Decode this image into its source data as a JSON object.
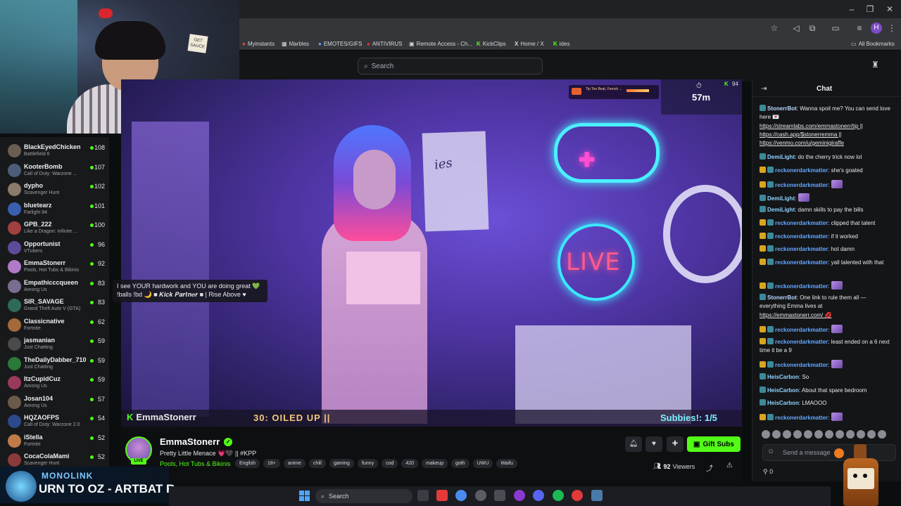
{
  "browser": {
    "bookmarks": [
      {
        "label": "Myinstants",
        "icon": "bookmark-icon"
      },
      {
        "label": "Marbles",
        "icon": "grid-icon"
      },
      {
        "label": "EMOTES/GIFS",
        "icon": "globe-icon"
      },
      {
        "label": "ANTIVIRUS",
        "icon": "shield-icon"
      },
      {
        "label": "Remote Access - Ch...",
        "icon": "remote-icon"
      },
      {
        "label": "KickClips",
        "icon": "kick-icon"
      },
      {
        "label": "Home / X",
        "icon": "x-icon"
      },
      {
        "label": "ides",
        "icon": "kick-icon"
      }
    ],
    "all_bookmarks": "All Bookmarks",
    "profile_initial": "H"
  },
  "header": {
    "search_placeholder": "Search"
  },
  "sidebar": {
    "channels": [
      {
        "name": "BlackEyedChicken",
        "category": "Battlefield 6",
        "viewers": "108",
        "color": "#6a5d52"
      },
      {
        "name": "KooterBomb",
        "category": "Call of Duty: Warzone ...",
        "viewers": "107",
        "color": "#4c5d7a"
      },
      {
        "name": "dypho",
        "category": "Scavenger Hunt",
        "viewers": "102",
        "color": "#8a7b6a"
      },
      {
        "name": "bluetearz",
        "category": "Farlight 84",
        "viewers": "101",
        "color": "#3a5fb0"
      },
      {
        "name": "GPB_222",
        "category": "Like a Dragon: Infinite ...",
        "viewers": "100",
        "color": "#a04040"
      },
      {
        "name": "Opportunist",
        "category": "VTubers",
        "viewers": "96",
        "color": "#5d4b9a"
      },
      {
        "name": "EmmaStonerr",
        "category": "Pools, Hot Tubs & Bikinis",
        "viewers": "92",
        "color": "#b07ac9"
      },
      {
        "name": "Empathicccqueen",
        "category": "Among Us",
        "viewers": "83",
        "color": "#7a6e90"
      },
      {
        "name": "SIR_SAVAGE",
        "category": "Grand Theft Auto V (GTA)",
        "viewers": "83",
        "color": "#2f6a58"
      },
      {
        "name": "Classicnative",
        "category": "Fortnite",
        "viewers": "62",
        "color": "#a46a3b"
      },
      {
        "name": "jasmanian",
        "category": "Just Chatting",
        "viewers": "59",
        "color": "#4a4a4a"
      },
      {
        "name": "TheDailyDabber_710",
        "category": "Just Chatting",
        "viewers": "59",
        "color": "#2a7a3a"
      },
      {
        "name": "ItzCupidCuz",
        "category": "Among Us",
        "viewers": "59",
        "color": "#9a3a5a"
      },
      {
        "name": "Josan104",
        "category": "Among Us",
        "viewers": "57",
        "color": "#6a5a4a"
      },
      {
        "name": "HQZAOFPS",
        "category": "Call of Duty: Warzone 2.0",
        "viewers": "54",
        "color": "#2a4a8a"
      },
      {
        "name": "iStella",
        "category": "Fortnite",
        "viewers": "52",
        "color": "#c07a4a"
      },
      {
        "name": "CocaColaMami",
        "category": "Scavenger Hunt",
        "viewers": "52",
        "color": "#8a3a3a"
      }
    ]
  },
  "webcam": {
    "sign_text": "GET SAUCE"
  },
  "video": {
    "overlay_name": "EmmaStonerr",
    "goal_text": "30: OILED UP ||",
    "subbies": "Subbies!: 1/5",
    "alert_text": "Tip Toe Beat, French ...",
    "timer_count": "94",
    "timer_time": "57m",
    "board_text": "ies",
    "neon_live": "LIVE"
  },
  "tooltip": {
    "line1": "I see YOUR hardwork and YOU are doing great 💚",
    "line2": "!balls !bd 🌙 ■ 𝑲𝒊𝒄𝒌 𝑷𝒂𝒓𝒕𝒏𝒆𝒓 ■ | Rise Above ♥"
  },
  "stream_info": {
    "name": "EmmaStonerr",
    "live_badge": "LIVE",
    "title": "Pretty Little Menace 💗🖤 || #KPP",
    "category": "Pools, Hot Tubs & Bikinis",
    "tags": [
      "English",
      "18+",
      "anime",
      "chill",
      "gaming",
      "funny",
      "cod",
      "420",
      "makeup",
      "goth",
      "UWU",
      "Waifu"
    ],
    "gift_subs": "Gift Subs",
    "viewers": "92",
    "viewers_label": "Viewers"
  },
  "chat": {
    "title": "Chat",
    "input_placeholder": "Send a message",
    "points": "0",
    "messages": [
      {
        "user": "StonerrBot",
        "color": "#b8d7ff",
        "text": ": Wanna spoil me? You can send love here 💌"
      },
      {
        "user": "",
        "color": "",
        "text": "https://streamlabs.com/emmastonerr/tip ||"
      },
      {
        "user": "",
        "color": "",
        "text": "https://cash.app/$stonerremma ||"
      },
      {
        "user": "",
        "color": "",
        "text": "https://venmo.com/u/geminigiraffe"
      },
      {
        "user": "DemiLight",
        "color": "#8fd3ff",
        "text": ": do the cherry trick now lol"
      },
      {
        "user": "reckonerdarkmatter",
        "color": "#64a7ff",
        "text": ": she's goated"
      },
      {
        "user": "reckonerdarkmatter",
        "color": "#64a7ff",
        "text": ":"
      },
      {
        "user": "DemiLight",
        "color": "#8fd3ff",
        "text": ":"
      },
      {
        "user": "DemiLight",
        "color": "#8fd3ff",
        "text": ": damn skills to pay the bills"
      },
      {
        "user": "reckonerdarkmatter",
        "color": "#64a7ff",
        "text": ": clipped that talent"
      },
      {
        "user": "reckonerdarkmatter",
        "color": "#64a7ff",
        "text": ": if it worked"
      },
      {
        "user": "reckonerdarkmatter",
        "color": "#64a7ff",
        "text": ": hot damn"
      },
      {
        "user": "reckonerdarkmatter",
        "color": "#64a7ff",
        "text": ": yall talented with that"
      },
      {
        "user": "reckonerdarkmatter",
        "color": "#64a7ff",
        "text": ":"
      },
      {
        "user": "StonerrBot",
        "color": "#b8d7ff",
        "text": ": One link to rule them all — everything Emma lives at"
      },
      {
        "user": "",
        "color": "",
        "text": "https://emmastonerr.com/ 💋"
      },
      {
        "user": "reckonerdarkmatter",
        "color": "#64a7ff",
        "text": ":"
      },
      {
        "user": "reckonerdarkmatter",
        "color": "#64a7ff",
        "text": ": least ended on a 6 next time it be a 9"
      },
      {
        "user": "reckonerdarkmatter",
        "color": "#64a7ff",
        "text": ":"
      },
      {
        "user": "HeisCarbon",
        "color": "#8fd3ff",
        "text": ": So"
      },
      {
        "user": "HeisCarbon",
        "color": "#8fd3ff",
        "text": ": About that spare bedroom"
      },
      {
        "user": "HeisCarbon",
        "color": "#8fd3ff",
        "text": ": LMAOOO"
      },
      {
        "user": "reckonerdarkmatter",
        "color": "#64a7ff",
        "text": ":"
      }
    ]
  },
  "now_playing": {
    "artist": "MONOLINK",
    "title": "URN TO OZ - ARTBAT R"
  },
  "taskbar": {
    "search_placeholder": "Search"
  }
}
